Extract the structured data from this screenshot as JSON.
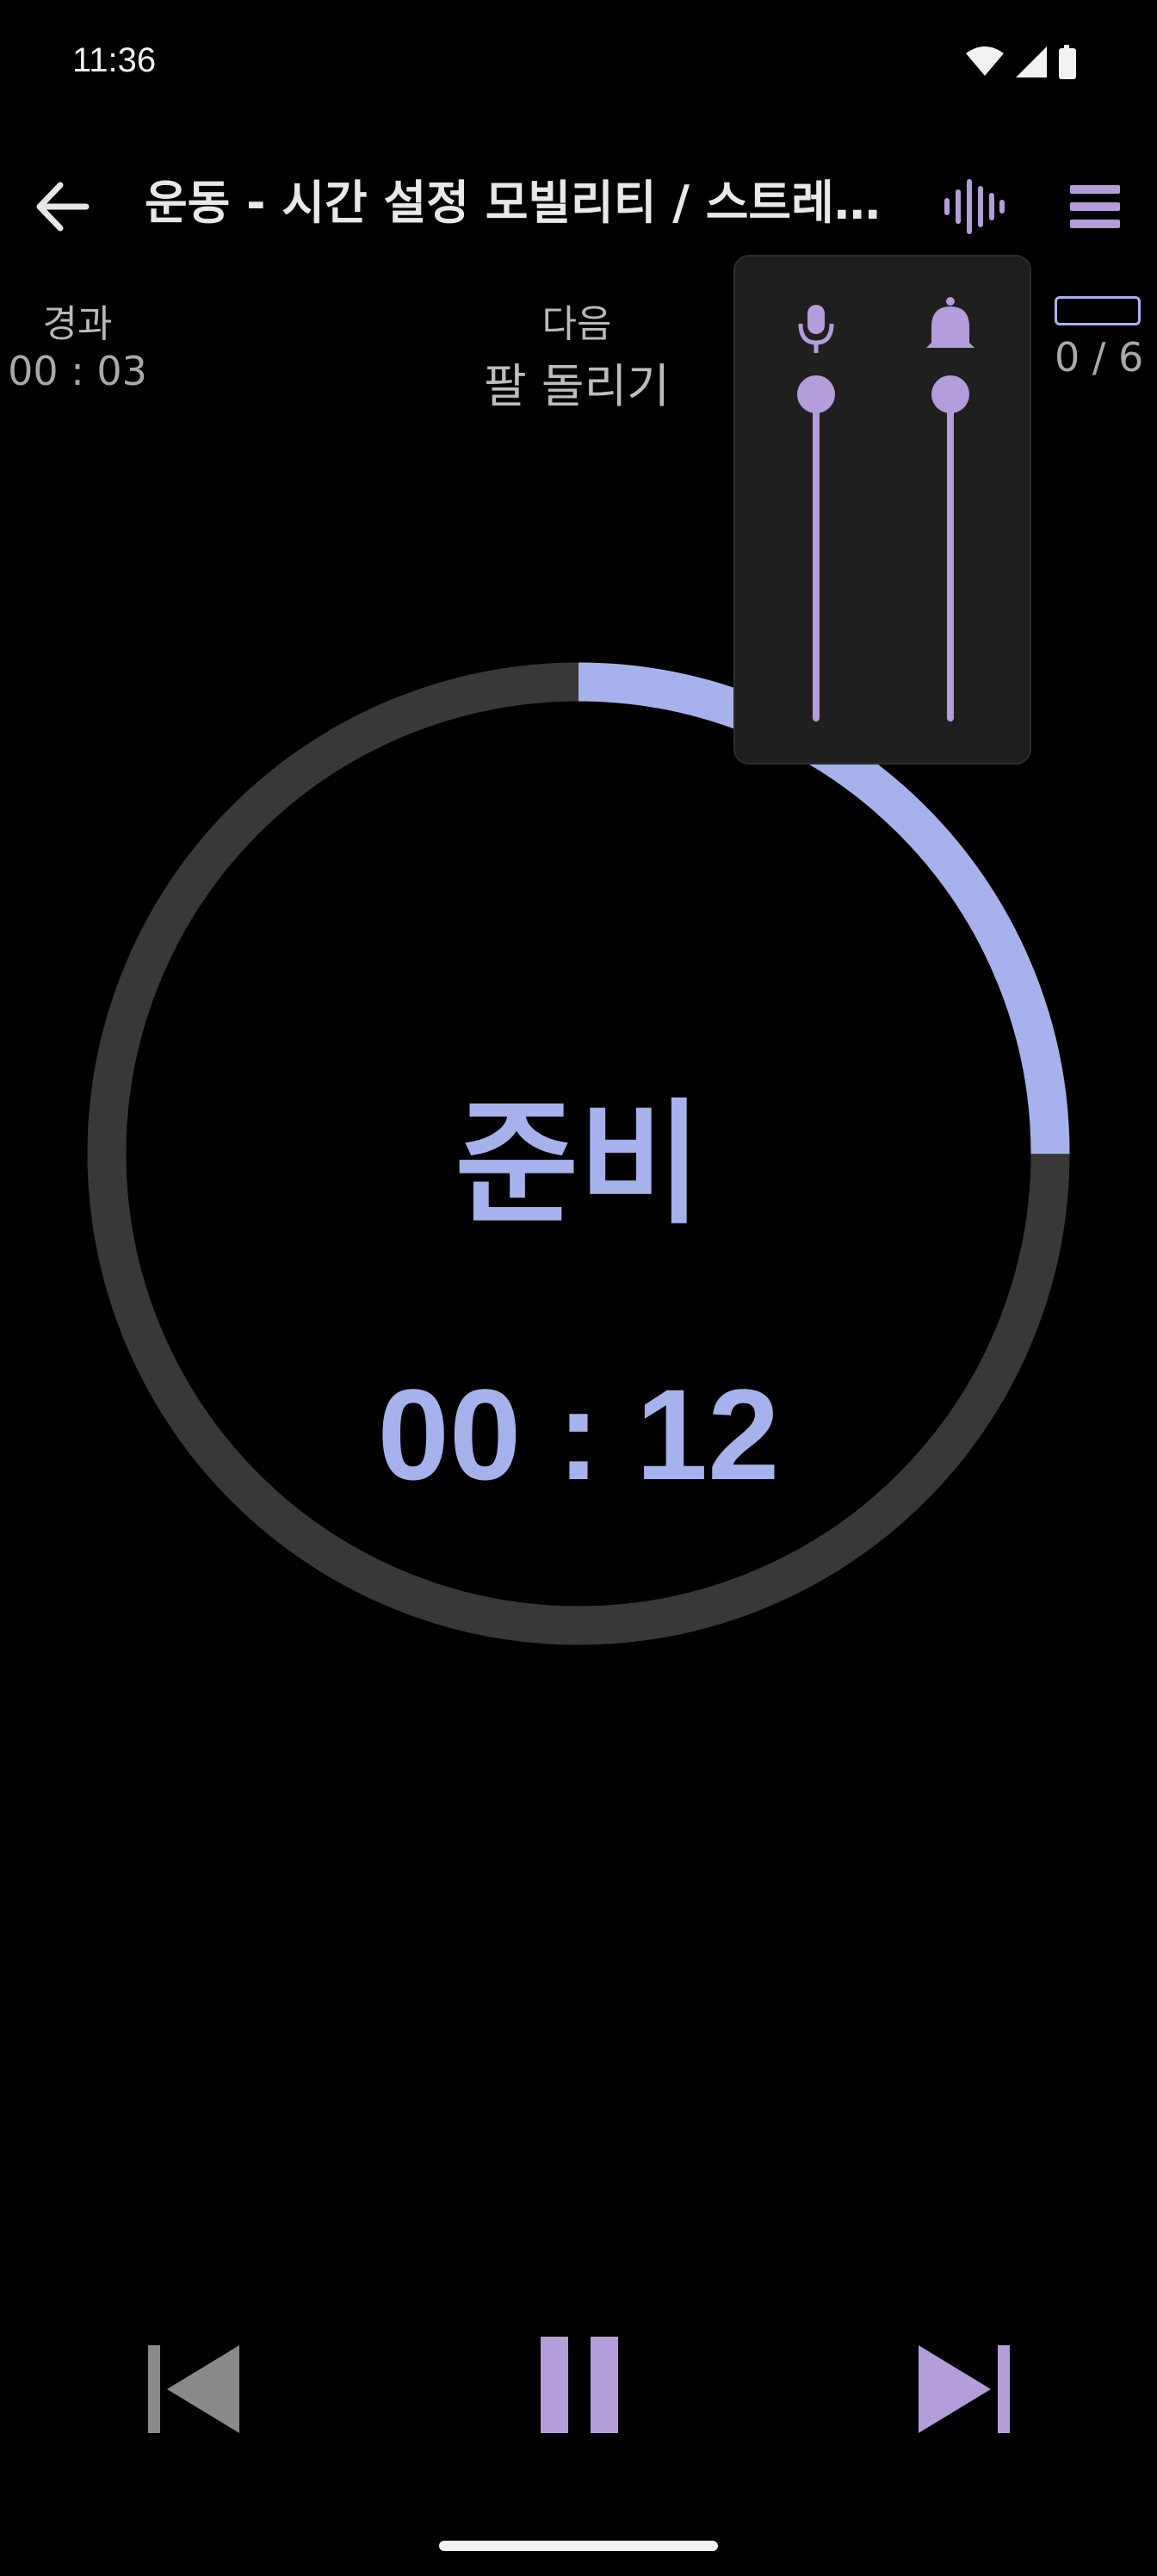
{
  "status_bar": {
    "time": "11:36",
    "icons": [
      "wifi-icon",
      "signal-icon",
      "battery-icon"
    ]
  },
  "app_bar": {
    "title": "운동 - 시간 설정 모빌리티 / 스트레칭...",
    "back_icon": "arrow-left-icon",
    "actions": [
      "waveform-icon",
      "menu-icon"
    ]
  },
  "info": {
    "elapsed_label": "경과",
    "elapsed_value": "00 : 03",
    "next_label": "다음",
    "next_value": "팔 돌리기",
    "progress_value": "0 / 6"
  },
  "timer": {
    "phase": "준비",
    "countdown": "00 : 12",
    "ring_progress": 0.25
  },
  "volume_popup": {
    "sliders": [
      {
        "name": "voice-volume",
        "icon": "mic-icon",
        "level": 1.0
      },
      {
        "name": "bell-volume",
        "icon": "bell-icon",
        "level": 1.0
      }
    ]
  },
  "controls": [
    "skip-previous-icon",
    "pause-icon",
    "skip-next-icon"
  ],
  "colors": {
    "accent": "#a7b2ec",
    "purple": "#b39ddb",
    "track": "#383838",
    "background": "#000000"
  }
}
